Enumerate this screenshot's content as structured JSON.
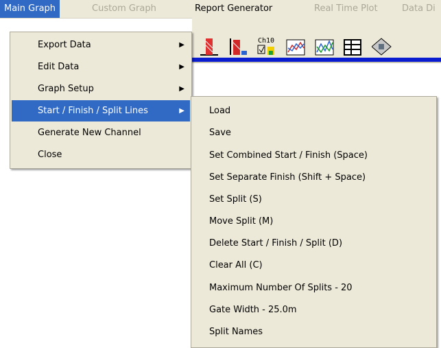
{
  "menubar": {
    "items": [
      {
        "label": "Main Graph",
        "state": "active"
      },
      {
        "label": "Custom Graph",
        "state": "disabled"
      },
      {
        "label": "Report Generator",
        "state": "normal"
      },
      {
        "label": "Real Time Plot",
        "state": "disabled"
      },
      {
        "label": "Data Di",
        "state": "disabled"
      }
    ]
  },
  "toolbar": {
    "icons": [
      "chart-red-icon",
      "chart-red-icon-2",
      "channel-icon",
      "graph-icon",
      "graph-alt-icon",
      "table-icon",
      "calculator-icon"
    ],
    "channel_label": "Ch10"
  },
  "main_menu": {
    "items": [
      {
        "label": "Export Data",
        "submenu": true
      },
      {
        "label": "Edit Data",
        "submenu": true
      },
      {
        "label": "Graph Setup",
        "submenu": true
      },
      {
        "label": "Start / Finish / Split Lines",
        "submenu": true,
        "highlighted": true
      },
      {
        "label": "Generate New Channel",
        "submenu": false
      },
      {
        "label": "Close",
        "submenu": false
      }
    ]
  },
  "sub_menu": {
    "items": [
      "Load",
      "Save",
      "Set Combined Start / Finish (Space)",
      "Set Separate Finish (Shift + Space)",
      "Set Split (S)",
      "Move Split (M)",
      "Delete Start / Finish / Split (D)",
      "Clear All (C)",
      "Maximum Number Of Splits - 20",
      "Gate Width - 25.0m",
      "Split Names"
    ]
  }
}
